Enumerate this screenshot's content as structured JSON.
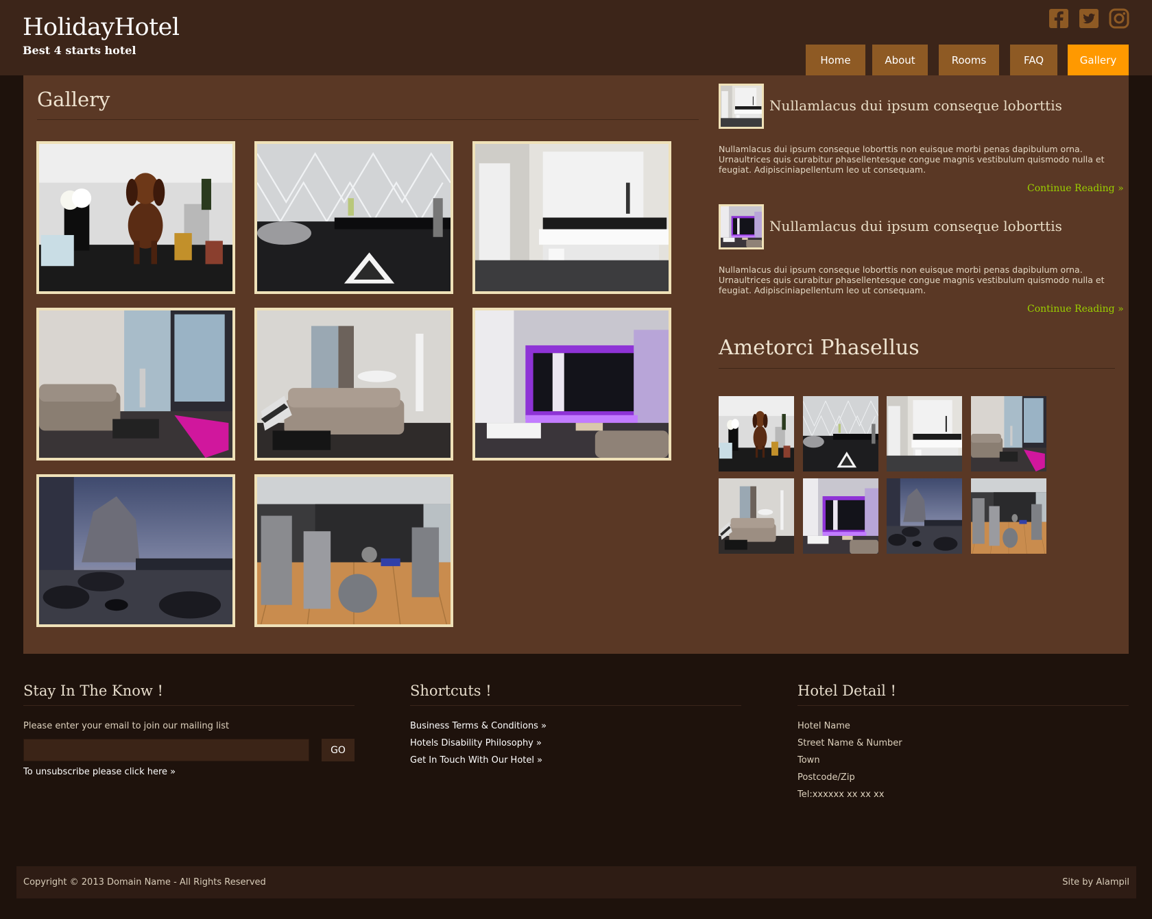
{
  "site": {
    "name": "HolidayHotel",
    "tagline": "Best 4 starts hotel",
    "social": [
      "facebook-icon",
      "twitter-icon",
      "instagram-icon"
    ],
    "colors": {
      "header_bg": "#3c2519",
      "content_bg": "#5a3825",
      "nav_bg": "#8e5a24",
      "nav_active": "#ff9900",
      "link_green": "#9bd000",
      "frame": "#efe1b8",
      "footer_bg": "#1e120c"
    }
  },
  "nav": {
    "items": [
      {
        "label": "Home"
      },
      {
        "label": "About"
      },
      {
        "label": "Rooms"
      },
      {
        "label": "FAQ"
      },
      {
        "label": "Gallery",
        "active": true
      }
    ]
  },
  "main": {
    "title": "Gallery",
    "images": [
      "dachshund-with-champagne",
      "modern-lobby-lounge",
      "marble-bathroom",
      "living-room-pink-light",
      "living-room-grey-sofa",
      "purple-lit-suite",
      "rooftop-terrace-dusk",
      "hotel-gym"
    ]
  },
  "sidebar": {
    "posts": [
      {
        "title": "Nullamlacus dui ipsum conseque loborttis",
        "body": "Nullamlacus dui ipsum conseque loborttis non euisque morbi penas dapibulum orna. Urnaultrices quis curabitur phasellentesque congue magnis vestibulum quismodo nulla et feugiat. Adipisciniapellentum leo ut consequam.",
        "link": "Continue Reading »"
      },
      {
        "title": "Nullamlacus dui ipsum conseque loborttis",
        "body": "Nullamlacus dui ipsum conseque loborttis non euisque morbi penas dapibulum orna. Urnaultrices quis curabitur phasellentesque congue magnis vestibulum quismodo nulla et feugiat. Adipisciniapellentum leo ut consequam.",
        "link": "Continue Reading »"
      }
    ],
    "gallery_title": "Ametorci Phasellus"
  },
  "footer": {
    "newsletter": {
      "title": "Stay In The Know !",
      "prompt": "Please enter your email to join our mailing list",
      "input_value": "",
      "button": "GO",
      "unsubscribe": "To unsubscribe please click here »"
    },
    "shortcuts": {
      "title": "Shortcuts !",
      "links": [
        "Business Terms & Conditions »",
        "Hotels Disability Philosophy »",
        "Get In Touch With Our Hotel »"
      ]
    },
    "hotel": {
      "title": "Hotel Detail !",
      "lines": [
        "Hotel Name",
        "Street Name & Number",
        "Town",
        "Postcode/Zip",
        "Tel:xxxxxx xx xx xx"
      ]
    },
    "copyright": "Copyright © 2013 Domain Name - All Rights Reserved",
    "credit": "Site by Alampil"
  }
}
